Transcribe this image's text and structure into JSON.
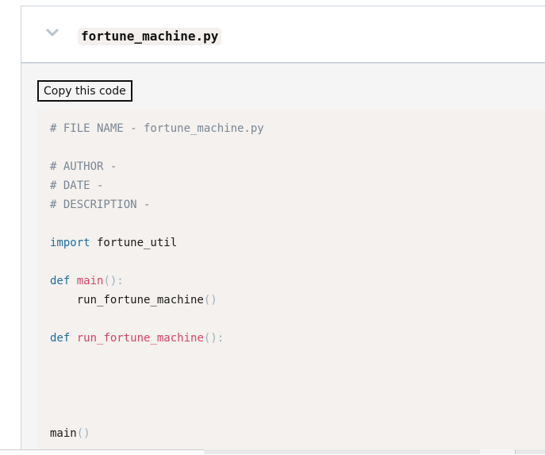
{
  "header": {
    "filename": "fortune_machine.py",
    "toggle_icon": "chevron-down-icon"
  },
  "toolbar": {
    "copy_label": "Copy this code"
  },
  "code": {
    "language": "python",
    "lines": [
      {
        "tokens": [
          {
            "t": "# FILE NAME - fortune_machine.py",
            "c": "cm"
          }
        ]
      },
      {
        "tokens": []
      },
      {
        "tokens": [
          {
            "t": "# AUTHOR -",
            "c": "cm"
          }
        ]
      },
      {
        "tokens": [
          {
            "t": "# DATE -",
            "c": "cm"
          }
        ]
      },
      {
        "tokens": [
          {
            "t": "# DESCRIPTION -",
            "c": "cm"
          }
        ]
      },
      {
        "tokens": []
      },
      {
        "tokens": [
          {
            "t": "import",
            "c": "kw"
          },
          {
            "t": " fortune_util",
            "c": ""
          }
        ]
      },
      {
        "tokens": []
      },
      {
        "tokens": [
          {
            "t": "def",
            "c": "kw"
          },
          {
            "t": " ",
            "c": ""
          },
          {
            "t": "main",
            "c": "fn"
          },
          {
            "t": "():",
            "c": "pn"
          }
        ]
      },
      {
        "tokens": [
          {
            "t": "    run_fortune_machine",
            "c": ""
          },
          {
            "t": "()",
            "c": "pn"
          }
        ]
      },
      {
        "tokens": []
      },
      {
        "tokens": [
          {
            "t": "def",
            "c": "kw"
          },
          {
            "t": " ",
            "c": ""
          },
          {
            "t": "run_fortune_machine",
            "c": "fn"
          },
          {
            "t": "():",
            "c": "pn"
          }
        ]
      },
      {
        "tokens": []
      },
      {
        "tokens": []
      },
      {
        "tokens": []
      },
      {
        "tokens": []
      },
      {
        "tokens": [
          {
            "t": "main",
            "c": ""
          },
          {
            "t": "()",
            "c": "pn"
          }
        ]
      }
    ]
  },
  "colors": {
    "comment": "#7a8694",
    "keyword": "#1f6d9b",
    "function": "#d0456b",
    "punctuation": "#9ab0c0",
    "code_background": "#f4f1ee"
  }
}
